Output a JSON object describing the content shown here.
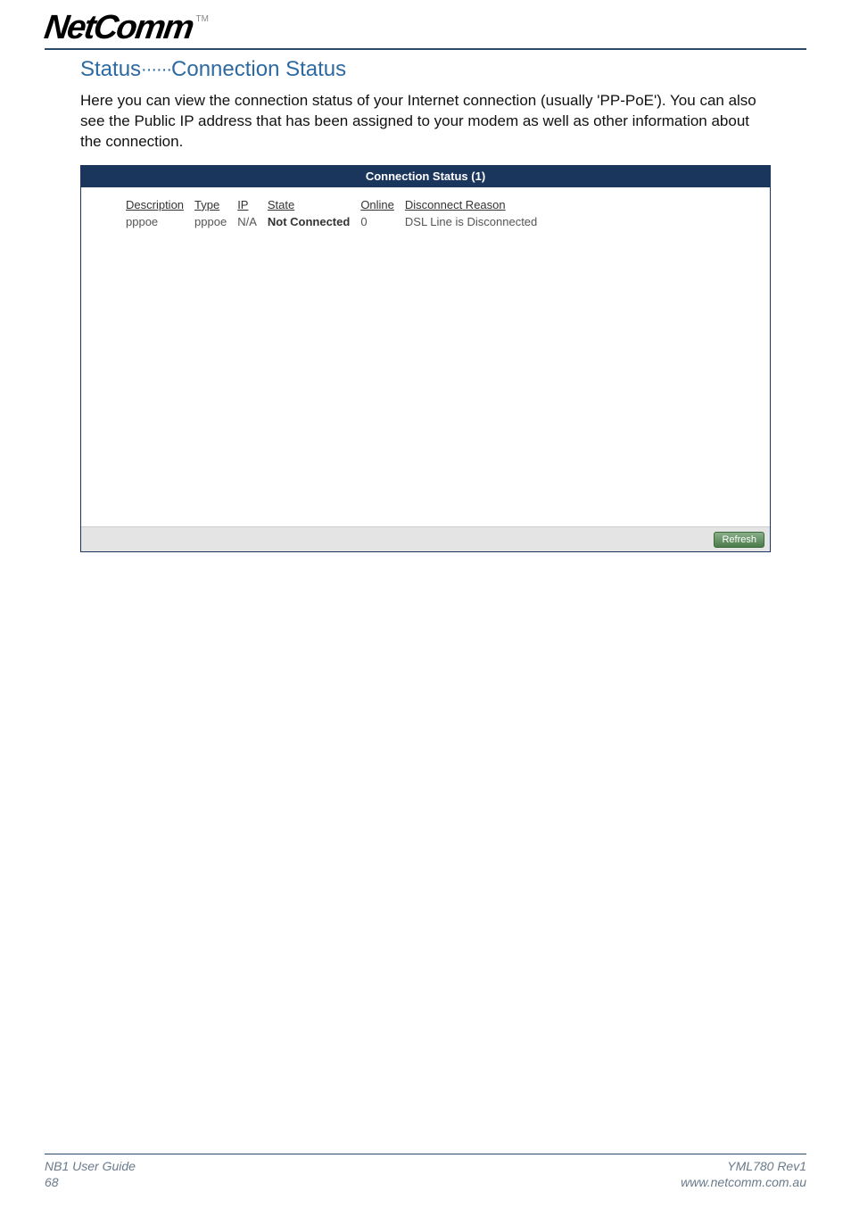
{
  "logo": {
    "text": "NetComm",
    "tm": "TM"
  },
  "breadcrumb": {
    "section": "Status",
    "sep": "······",
    "page": "Connection Status"
  },
  "intro": "Here you can view the connection status of your Internet connection (usually 'PP-PoE'). You can also see the Public IP address that has been assigned to your modem as well as other information about the connection.",
  "panel": {
    "title": "Connection Status (1)",
    "headers": {
      "description": "Description",
      "type": "Type",
      "ip": "IP",
      "state": "State",
      "online": "Online",
      "reason": "Disconnect Reason"
    },
    "rows": [
      {
        "description": "pppoe",
        "type": "pppoe",
        "ip": "N/A",
        "state": "Not Connected",
        "online": "0",
        "reason": "DSL Line is Disconnected"
      }
    ],
    "refresh_label": "Refresh"
  },
  "footer": {
    "left1": "NB1 User Guide",
    "left2": "68",
    "right1": "YML780 Rev1",
    "right2": "www.netcomm.com.au"
  }
}
